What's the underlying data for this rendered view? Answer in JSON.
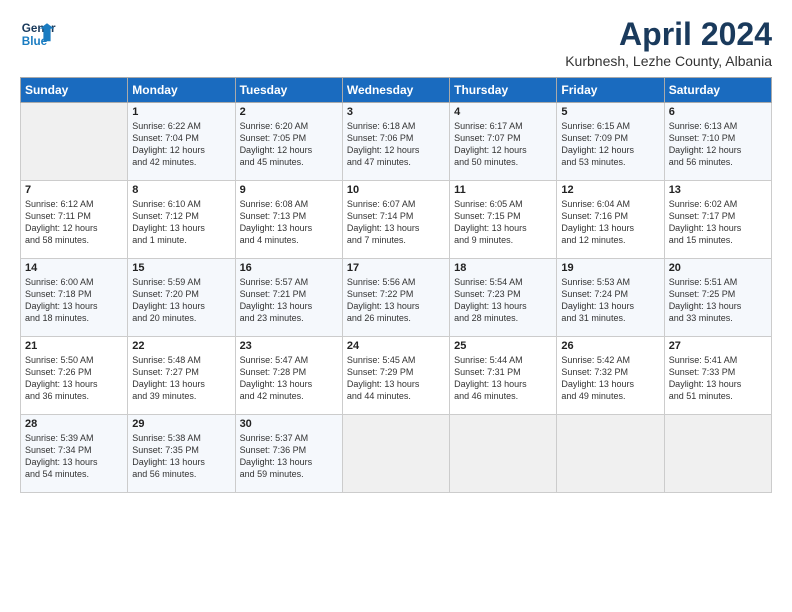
{
  "logo": {
    "line1": "General",
    "line2": "Blue"
  },
  "title": "April 2024",
  "subtitle": "Kurbnesh, Lezhe County, Albania",
  "weekdays": [
    "Sunday",
    "Monday",
    "Tuesday",
    "Wednesday",
    "Thursday",
    "Friday",
    "Saturday"
  ],
  "weeks": [
    [
      {
        "day": "",
        "text": ""
      },
      {
        "day": "1",
        "text": "Sunrise: 6:22 AM\nSunset: 7:04 PM\nDaylight: 12 hours\nand 42 minutes."
      },
      {
        "day": "2",
        "text": "Sunrise: 6:20 AM\nSunset: 7:05 PM\nDaylight: 12 hours\nand 45 minutes."
      },
      {
        "day": "3",
        "text": "Sunrise: 6:18 AM\nSunset: 7:06 PM\nDaylight: 12 hours\nand 47 minutes."
      },
      {
        "day": "4",
        "text": "Sunrise: 6:17 AM\nSunset: 7:07 PM\nDaylight: 12 hours\nand 50 minutes."
      },
      {
        "day": "5",
        "text": "Sunrise: 6:15 AM\nSunset: 7:09 PM\nDaylight: 12 hours\nand 53 minutes."
      },
      {
        "day": "6",
        "text": "Sunrise: 6:13 AM\nSunset: 7:10 PM\nDaylight: 12 hours\nand 56 minutes."
      }
    ],
    [
      {
        "day": "7",
        "text": "Sunrise: 6:12 AM\nSunset: 7:11 PM\nDaylight: 12 hours\nand 58 minutes."
      },
      {
        "day": "8",
        "text": "Sunrise: 6:10 AM\nSunset: 7:12 PM\nDaylight: 13 hours\nand 1 minute."
      },
      {
        "day": "9",
        "text": "Sunrise: 6:08 AM\nSunset: 7:13 PM\nDaylight: 13 hours\nand 4 minutes."
      },
      {
        "day": "10",
        "text": "Sunrise: 6:07 AM\nSunset: 7:14 PM\nDaylight: 13 hours\nand 7 minutes."
      },
      {
        "day": "11",
        "text": "Sunrise: 6:05 AM\nSunset: 7:15 PM\nDaylight: 13 hours\nand 9 minutes."
      },
      {
        "day": "12",
        "text": "Sunrise: 6:04 AM\nSunset: 7:16 PM\nDaylight: 13 hours\nand 12 minutes."
      },
      {
        "day": "13",
        "text": "Sunrise: 6:02 AM\nSunset: 7:17 PM\nDaylight: 13 hours\nand 15 minutes."
      }
    ],
    [
      {
        "day": "14",
        "text": "Sunrise: 6:00 AM\nSunset: 7:18 PM\nDaylight: 13 hours\nand 18 minutes."
      },
      {
        "day": "15",
        "text": "Sunrise: 5:59 AM\nSunset: 7:20 PM\nDaylight: 13 hours\nand 20 minutes."
      },
      {
        "day": "16",
        "text": "Sunrise: 5:57 AM\nSunset: 7:21 PM\nDaylight: 13 hours\nand 23 minutes."
      },
      {
        "day": "17",
        "text": "Sunrise: 5:56 AM\nSunset: 7:22 PM\nDaylight: 13 hours\nand 26 minutes."
      },
      {
        "day": "18",
        "text": "Sunrise: 5:54 AM\nSunset: 7:23 PM\nDaylight: 13 hours\nand 28 minutes."
      },
      {
        "day": "19",
        "text": "Sunrise: 5:53 AM\nSunset: 7:24 PM\nDaylight: 13 hours\nand 31 minutes."
      },
      {
        "day": "20",
        "text": "Sunrise: 5:51 AM\nSunset: 7:25 PM\nDaylight: 13 hours\nand 33 minutes."
      }
    ],
    [
      {
        "day": "21",
        "text": "Sunrise: 5:50 AM\nSunset: 7:26 PM\nDaylight: 13 hours\nand 36 minutes."
      },
      {
        "day": "22",
        "text": "Sunrise: 5:48 AM\nSunset: 7:27 PM\nDaylight: 13 hours\nand 39 minutes."
      },
      {
        "day": "23",
        "text": "Sunrise: 5:47 AM\nSunset: 7:28 PM\nDaylight: 13 hours\nand 42 minutes."
      },
      {
        "day": "24",
        "text": "Sunrise: 5:45 AM\nSunset: 7:29 PM\nDaylight: 13 hours\nand 44 minutes."
      },
      {
        "day": "25",
        "text": "Sunrise: 5:44 AM\nSunset: 7:31 PM\nDaylight: 13 hours\nand 46 minutes."
      },
      {
        "day": "26",
        "text": "Sunrise: 5:42 AM\nSunset: 7:32 PM\nDaylight: 13 hours\nand 49 minutes."
      },
      {
        "day": "27",
        "text": "Sunrise: 5:41 AM\nSunset: 7:33 PM\nDaylight: 13 hours\nand 51 minutes."
      }
    ],
    [
      {
        "day": "28",
        "text": "Sunrise: 5:39 AM\nSunset: 7:34 PM\nDaylight: 13 hours\nand 54 minutes."
      },
      {
        "day": "29",
        "text": "Sunrise: 5:38 AM\nSunset: 7:35 PM\nDaylight: 13 hours\nand 56 minutes."
      },
      {
        "day": "30",
        "text": "Sunrise: 5:37 AM\nSunset: 7:36 PM\nDaylight: 13 hours\nand 59 minutes."
      },
      {
        "day": "",
        "text": ""
      },
      {
        "day": "",
        "text": ""
      },
      {
        "day": "",
        "text": ""
      },
      {
        "day": "",
        "text": ""
      }
    ]
  ]
}
